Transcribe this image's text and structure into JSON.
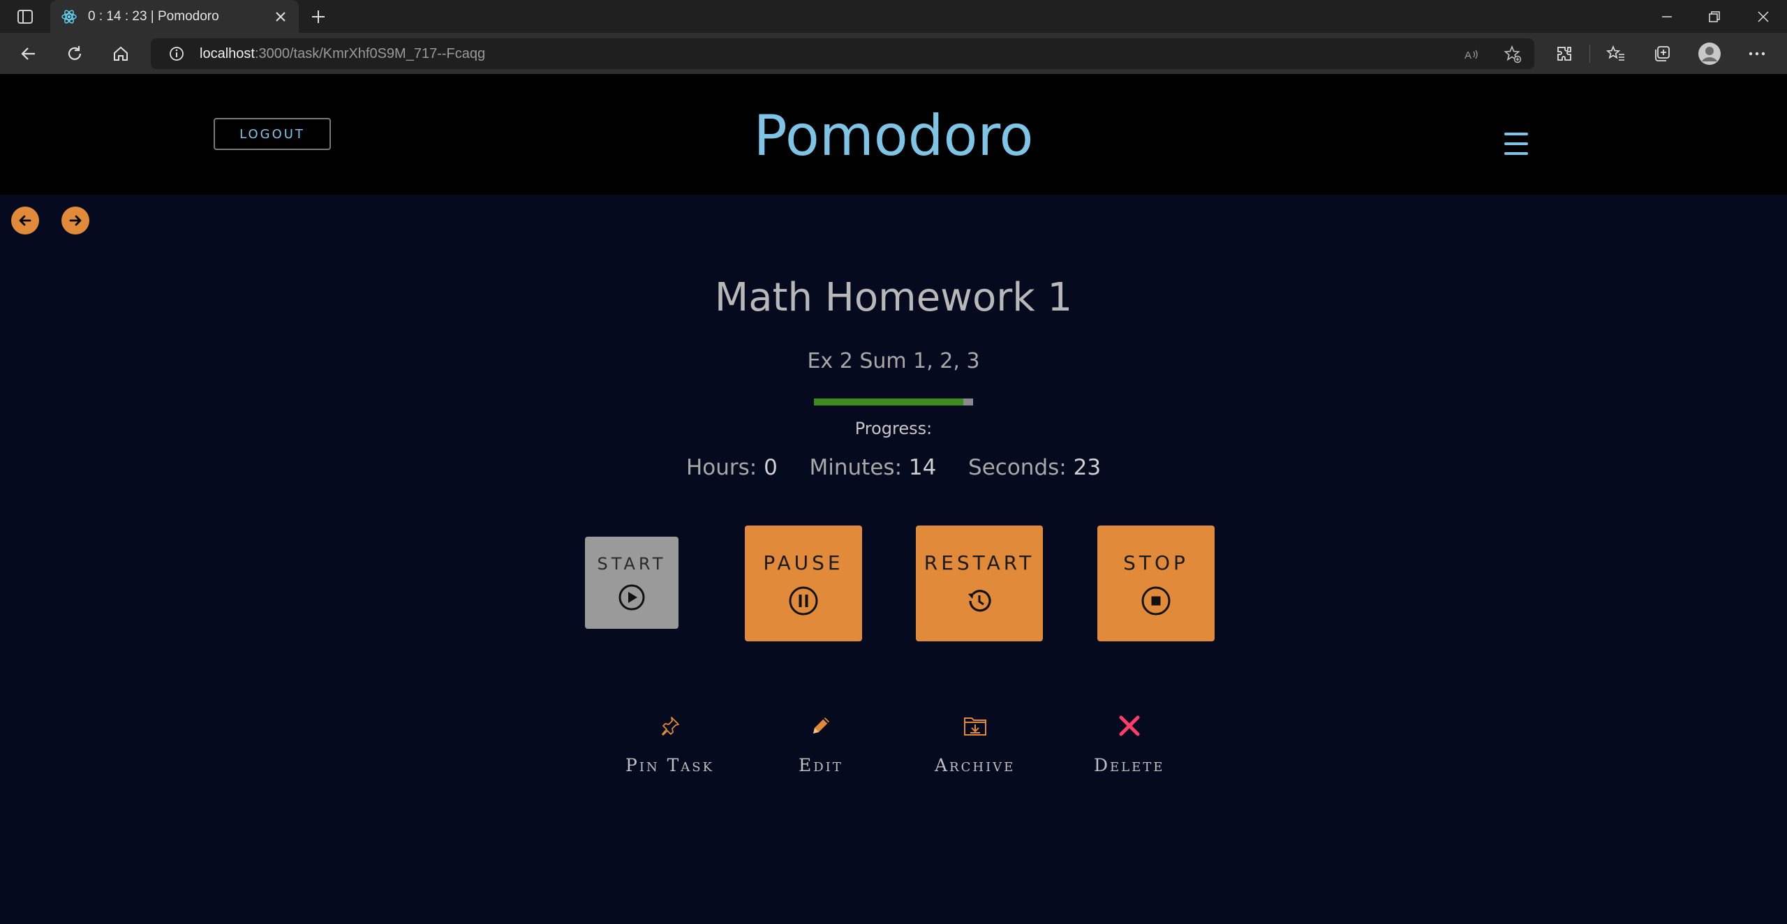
{
  "browser": {
    "tab_title": "0 : 14 : 23 | Pomodoro",
    "url_host": "localhost",
    "url_path": ":3000/task/KmrXhf0S9M_717--Fcaqg"
  },
  "header": {
    "logout_label": "LOGOUT",
    "app_title": "Pomodoro"
  },
  "task": {
    "title": "Math Homework 1",
    "description": "Ex 2 Sum 1, 2, 3",
    "progress_fraction": 0.94,
    "progress_label": "Progress:",
    "progress_color": "#3d8a1f"
  },
  "timer": {
    "hours_label": "Hours:",
    "hours": "0",
    "minutes_label": "Minutes:",
    "minutes": "14",
    "seconds_label": "Seconds:",
    "seconds": "23"
  },
  "controls": {
    "start": "START",
    "pause": "PAUSE",
    "restart": "RESTART",
    "stop": "STOP"
  },
  "actions": {
    "pin": "Pin Task",
    "edit": "Edit",
    "archive": "Archive",
    "delete": "Delete"
  },
  "colors": {
    "accent": "#7ec4e6",
    "button_orange": "#e08a3a",
    "disabled_gray": "#9a9a9a",
    "delete_red": "#ff3b6b",
    "background": "#050a1f"
  }
}
